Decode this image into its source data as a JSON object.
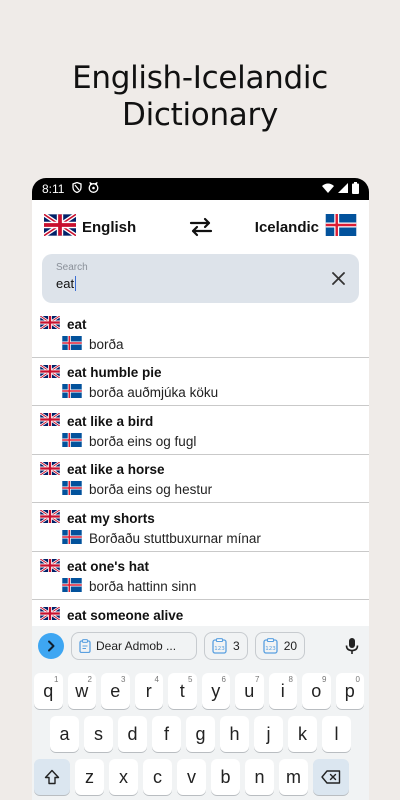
{
  "promo": {
    "title_line1": "English-Icelandic",
    "title_line2": "Dictionary"
  },
  "status_bar": {
    "time": "8:11",
    "icons": [
      "shield-icon",
      "cat-icon",
      "wifi-icon",
      "signal-icon",
      "battery-icon"
    ]
  },
  "languages": {
    "source": "English",
    "target": "Icelandic",
    "source_flag": "uk-flag-icon",
    "target_flag": "iceland-flag-icon",
    "swap_icon": "swap-arrows-icon"
  },
  "search": {
    "label": "Search",
    "value": "eat",
    "clear_icon": "close-icon"
  },
  "results": [
    {
      "en": "eat",
      "is": "borða"
    },
    {
      "en": "eat humble pie",
      "is": "borða auðmjúka köku"
    },
    {
      "en": "eat like a bird",
      "is": "borða eins og fugl"
    },
    {
      "en": "eat like a horse",
      "is": "borða eins og hestur"
    },
    {
      "en": "eat my shorts",
      "is": "Borðaðu stuttbuxurnar mínar"
    },
    {
      "en": "eat one's hat",
      "is": "borða hattinn sinn"
    },
    {
      "en": "eat someone alive",
      "is": ""
    }
  ],
  "keyboard": {
    "suggestions": [
      "Dear Admob ...",
      "3",
      "20"
    ],
    "row1": [
      {
        "k": "q",
        "h": "1"
      },
      {
        "k": "w",
        "h": "2"
      },
      {
        "k": "e",
        "h": "3"
      },
      {
        "k": "r",
        "h": "4"
      },
      {
        "k": "t",
        "h": "5"
      },
      {
        "k": "y",
        "h": "6"
      },
      {
        "k": "u",
        "h": "7"
      },
      {
        "k": "i",
        "h": "8"
      },
      {
        "k": "o",
        "h": "9"
      },
      {
        "k": "p",
        "h": "0"
      }
    ],
    "row2": [
      "a",
      "s",
      "d",
      "f",
      "g",
      "h",
      "j",
      "k",
      "l"
    ],
    "row3": [
      "z",
      "x",
      "c",
      "v",
      "b",
      "n",
      "m"
    ]
  },
  "colors": {
    "background": "#efebe8",
    "search_bg": "#dde3ea",
    "keyboard_bg": "#f1f3f4",
    "accent": "#3ea6f2"
  }
}
